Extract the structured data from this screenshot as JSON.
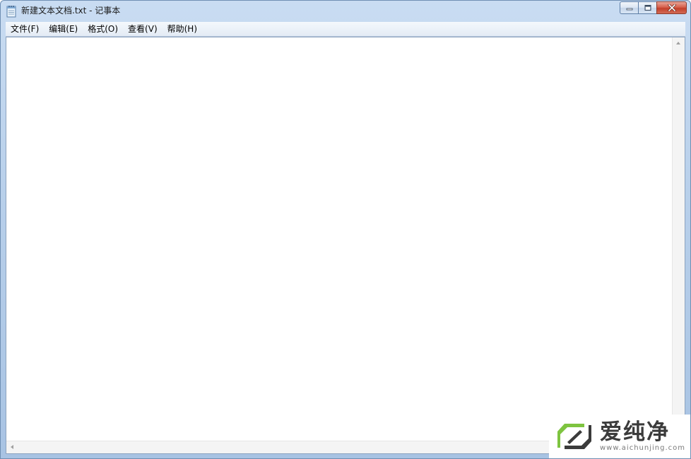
{
  "window": {
    "title": "新建文本文档.txt - 记事本"
  },
  "menu": {
    "items": [
      {
        "label": "文件(F)"
      },
      {
        "label": "编辑(E)"
      },
      {
        "label": "格式(O)"
      },
      {
        "label": "查看(V)"
      },
      {
        "label": "帮助(H)"
      }
    ]
  },
  "editor": {
    "content": ""
  },
  "watermark": {
    "brand": "爱纯净",
    "site": "www.aichunjing.com"
  },
  "colors": {
    "logo_green": "#7ec440",
    "close_red": "#c7452f",
    "titlebar_blue": "#b9d1ea"
  }
}
